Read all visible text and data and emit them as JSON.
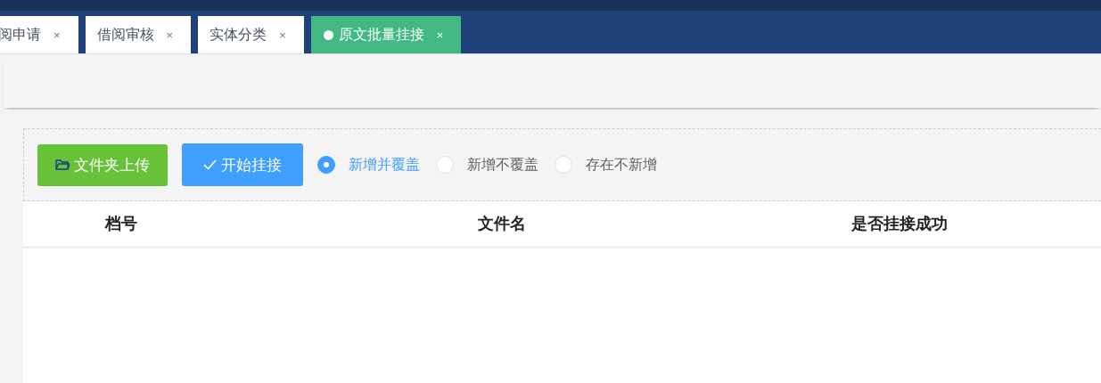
{
  "tabs": [
    {
      "label": "阅申请",
      "selected": false,
      "close": "×"
    },
    {
      "label": "借阅审核",
      "selected": false,
      "close": "×"
    },
    {
      "label": "实体分类",
      "selected": false,
      "close": "×"
    },
    {
      "label": "原文批量挂接",
      "selected": true,
      "close": "×"
    }
  ],
  "toolbar": {
    "buttons": [
      {
        "label": "文件夹上传",
        "kind": "upload"
      },
      {
        "label": "开始挂接",
        "kind": "start"
      }
    ],
    "options": [
      {
        "label": "新增并覆盖",
        "selected": true
      },
      {
        "label": "新增不覆盖",
        "selected": false
      },
      {
        "label": "存在不新增",
        "selected": false
      }
    ]
  },
  "table": {
    "columns": [
      "档号",
      "文件名",
      "是否挂接成功"
    ]
  }
}
